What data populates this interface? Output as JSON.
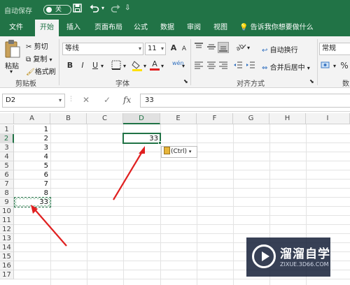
{
  "titlebar": {
    "autosave_label": "自动保存",
    "autosave_state": "关",
    "save_icon": "save-icon",
    "undo_icon": "undo-icon",
    "redo_icon": "redo-icon",
    "customize_icon": "chevron-down-icon"
  },
  "tabs": [
    {
      "label": "文件"
    },
    {
      "label": "开始"
    },
    {
      "label": "插入"
    },
    {
      "label": "页面布局"
    },
    {
      "label": "公式"
    },
    {
      "label": "数据"
    },
    {
      "label": "审阅"
    },
    {
      "label": "视图"
    }
  ],
  "active_tab": "开始",
  "tellme": "告诉我你想要做什么",
  "ribbon": {
    "clipboard": {
      "paste": "粘贴",
      "cut": "剪切",
      "copy": "复制",
      "format_painter": "格式刷",
      "group": "剪贴板"
    },
    "font": {
      "name": "等线",
      "size": "11",
      "bold": "B",
      "italic": "I",
      "underline": "U",
      "grow": "A",
      "shrink": "A",
      "font_color": "A",
      "phonetic": "wén",
      "group": "字体"
    },
    "alignment": {
      "wrap": "自动换行",
      "merge": "合并后居中",
      "group": "对齐方式"
    },
    "number": {
      "format": "常规",
      "group": "数"
    }
  },
  "formula_bar": {
    "name_box": "D2",
    "cancel": "✕",
    "enter": "✓",
    "fx": "fx",
    "value": "33"
  },
  "columns": [
    "A",
    "B",
    "C",
    "D",
    "E",
    "F",
    "G",
    "H",
    "I"
  ],
  "rows": [
    "1",
    "2",
    "3",
    "4",
    "5",
    "6",
    "7",
    "8",
    "9",
    "10",
    "11",
    "12",
    "13",
    "14",
    "15",
    "16",
    "17"
  ],
  "cells": {
    "A1": "1",
    "A2": "2",
    "A3": "3",
    "A4": "4",
    "A5": "5",
    "A6": "6",
    "A7": "7",
    "A8": "8",
    "A9": "33",
    "D2": "33"
  },
  "selected_cell": "D2",
  "copied_range": "A9",
  "paste_options": "(Ctrl)",
  "watermark": {
    "title": "溜溜自学",
    "url": "ZIXUE.3D66.COM"
  },
  "colors": {
    "accent": "#217346",
    "annotation_arrow": "#e02020"
  }
}
